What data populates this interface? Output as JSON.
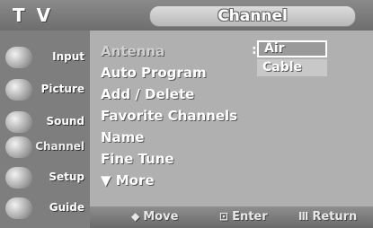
{
  "header": {
    "app_label": "T V",
    "title": "Channel"
  },
  "sidebar": {
    "items": [
      {
        "label": "Input",
        "icon": "input-icon"
      },
      {
        "label": "Picture",
        "icon": "picture-icon"
      },
      {
        "label": "Sound",
        "icon": "sound-icon"
      },
      {
        "label": "Channel",
        "icon": "channel-icon"
      },
      {
        "label": "Setup",
        "icon": "setup-icon"
      },
      {
        "label": "Guide",
        "icon": "guide-icon"
      }
    ]
  },
  "menu": {
    "items": [
      {
        "label": "Antenna"
      },
      {
        "label": "Auto Program"
      },
      {
        "label": "Add / Delete"
      },
      {
        "label": "Favorite Channels"
      },
      {
        "label": "Name"
      },
      {
        "label": "Fine Tune"
      },
      {
        "label": "▼ More"
      }
    ],
    "separator": ":"
  },
  "dropdown": {
    "selected": "Air",
    "other": "Cable"
  },
  "footer": {
    "move_glyph": "◆",
    "move": "Move",
    "enter_glyph": "⊡",
    "enter": "Enter",
    "return_glyph": "Ⅲ",
    "return": "Return"
  }
}
